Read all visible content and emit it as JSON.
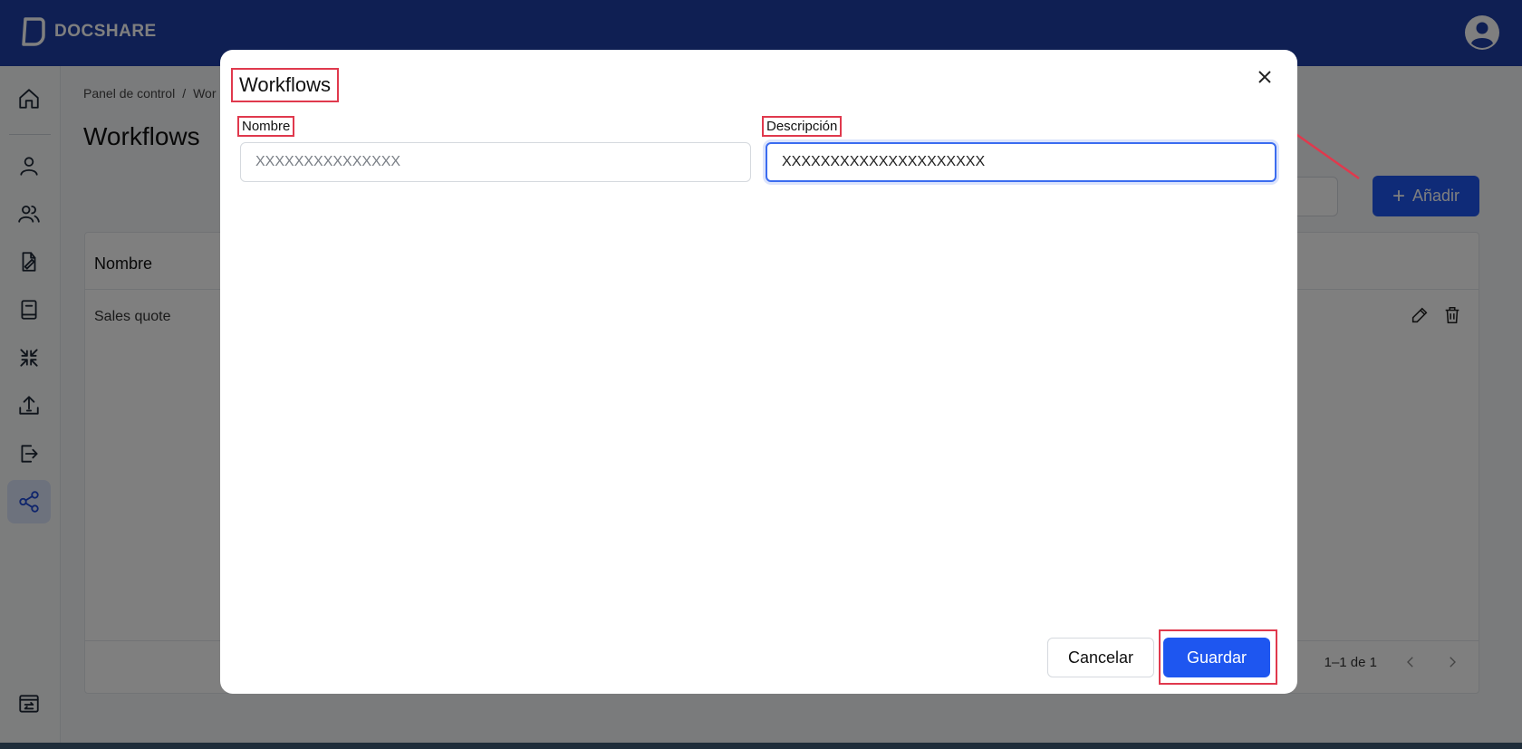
{
  "app": {
    "brand": "DOCSHARE"
  },
  "breadcrumb": {
    "home": "Panel de control",
    "separator": "/",
    "current": "Wor"
  },
  "page": {
    "title": "Workflows",
    "add_label": "Añadir"
  },
  "table": {
    "header_name": "Nombre",
    "rows": [
      {
        "name": "Sales quote"
      }
    ],
    "pagination": "1–1 de 1"
  },
  "sidebar": {
    "items": [
      {
        "icon": "home-icon"
      },
      {
        "icon": "user-icon"
      },
      {
        "icon": "users-icon"
      },
      {
        "icon": "document-sign-icon"
      },
      {
        "icon": "book-icon"
      },
      {
        "icon": "compress-icon"
      },
      {
        "icon": "upload-icon"
      },
      {
        "icon": "logout-icon"
      },
      {
        "icon": "share-icon",
        "active": true
      },
      {
        "icon": "transfer-icon"
      }
    ]
  },
  "modal": {
    "title": "Workflows",
    "name_label": "Nombre",
    "name_placeholder": "XXXXXXXXXXXXXXX",
    "description_label": "Descripción",
    "description_value": "XXXXXXXXXXXXXXXXXXXXX",
    "cancel_label": "Cancelar",
    "save_label": "Guardar"
  },
  "colors": {
    "brand": "#1e3fa6",
    "primary": "#1e56f0",
    "annotation": "#e0394d"
  }
}
